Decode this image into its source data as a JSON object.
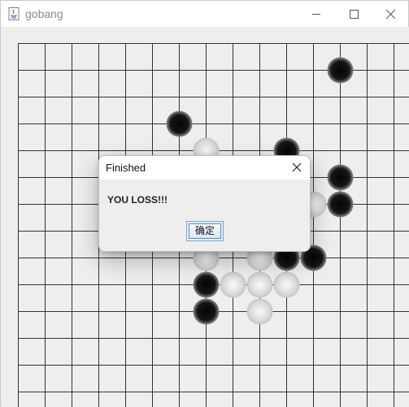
{
  "window": {
    "title": "gobang",
    "icon": "java-icon",
    "controls": [
      "minimize-icon",
      "maximize-icon",
      "close-icon"
    ]
  },
  "board": {
    "grid_size": 15,
    "line_color": "#333333",
    "background": "#eeeeee",
    "black_stone_color": "#111111",
    "white_stone_color": "#d8d8d8",
    "stones": [
      {
        "col": 12,
        "row": 1,
        "color": "black"
      },
      {
        "col": 6,
        "row": 3,
        "color": "black"
      },
      {
        "col": 7,
        "row": 4,
        "color": "white"
      },
      {
        "col": 10,
        "row": 4,
        "color": "black"
      },
      {
        "col": 12,
        "row": 5,
        "color": "black"
      },
      {
        "col": 12,
        "row": 6,
        "color": "black"
      },
      {
        "col": 11,
        "row": 6,
        "color": "white"
      },
      {
        "col": 7,
        "row": 8,
        "color": "white"
      },
      {
        "col": 9,
        "row": 8,
        "color": "white"
      },
      {
        "col": 10,
        "row": 8,
        "color": "black"
      },
      {
        "col": 11,
        "row": 8,
        "color": "black"
      },
      {
        "col": 7,
        "row": 9,
        "color": "black"
      },
      {
        "col": 8,
        "row": 9,
        "color": "white"
      },
      {
        "col": 9,
        "row": 9,
        "color": "white"
      },
      {
        "col": 10,
        "row": 9,
        "color": "white"
      },
      {
        "col": 7,
        "row": 10,
        "color": "black"
      },
      {
        "col": 9,
        "row": 10,
        "color": "white"
      }
    ]
  },
  "dialog": {
    "title": "Finished",
    "message": "YOU LOSS!!!",
    "ok_label": "确定"
  }
}
